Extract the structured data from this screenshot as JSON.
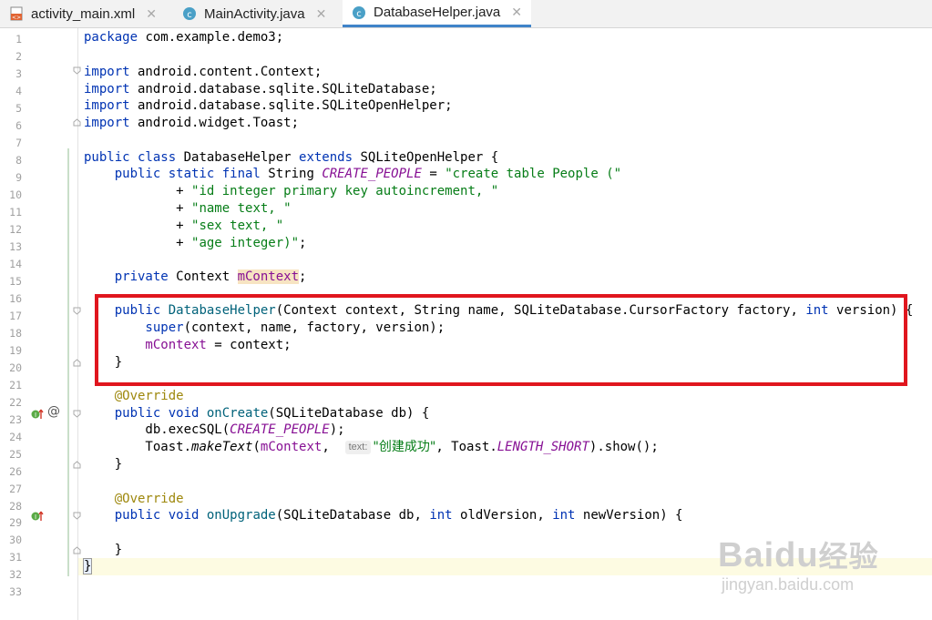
{
  "tabs": [
    {
      "label": "activity_main.xml",
      "icon": "xml-file-icon"
    },
    {
      "label": "MainActivity.java",
      "icon": "java-class-icon"
    },
    {
      "label": "DatabaseHelper.java",
      "icon": "java-class-icon",
      "active": true
    }
  ],
  "line_numbers": [
    "1",
    "2",
    "3",
    "4",
    "5",
    "6",
    "7",
    "8",
    "9",
    "10",
    "11",
    "12",
    "13",
    "14",
    "15",
    "16",
    "17",
    "18",
    "19",
    "20",
    "21",
    "22",
    "23",
    "24",
    "25",
    "26",
    "27",
    "28",
    "29",
    "30",
    "31",
    "32",
    "33"
  ],
  "code": {
    "l1": {
      "kw": "package",
      "rest": " com.example.demo3;"
    },
    "l3": {
      "kw": "import",
      "rest": " android.content.Context;"
    },
    "l4": {
      "kw": "import",
      "rest": " android.database.sqlite.SQLiteDatabase;"
    },
    "l5": {
      "kw": "import",
      "rest": " android.database.sqlite.SQLiteOpenHelper;"
    },
    "l6": {
      "kw": "import",
      "rest": " android.widget.Toast;"
    },
    "l8": {
      "kw1": "public class",
      "name": " DatabaseHelper ",
      "kw2": "extends",
      "rest": " SQLiteOpenHelper {"
    },
    "l9": {
      "kw": "    public static final",
      "type": " String ",
      "const": "CREATE_PEOPLE",
      "eq": " = ",
      "str": "\"create table People (\""
    },
    "l10": {
      "plus": "            + ",
      "str": "\"id integer primary key autoincrement, \""
    },
    "l11": {
      "plus": "            + ",
      "str": "\"name text, \""
    },
    "l12": {
      "plus": "            + ",
      "str": "\"sex text, \""
    },
    "l13": {
      "plus": "            + ",
      "str": "\"age integer)\"",
      "end": ";"
    },
    "l15": {
      "kw": "    private",
      "type": " Context ",
      "field": "mContext",
      "end": ";"
    },
    "l17": {
      "kw": "    public",
      "ctor": " DatabaseHelper",
      "args": "(Context context, String name, SQLiteDatabase.CursorFactory factory, ",
      "kw2": "int",
      "rest": " version) {"
    },
    "l18": {
      "kw": "        super",
      "rest": "(context, name, factory, version);"
    },
    "l19": {
      "field": "        mContext",
      "rest": " = context;"
    },
    "l20": {
      "rest": "    }"
    },
    "l22": {
      "ann": "    @Override"
    },
    "l23": {
      "kw": "    public void",
      "fn": " onCreate",
      "rest": "(SQLiteDatabase db) {"
    },
    "l24": {
      "pre": "        db.execSQL(",
      "const": "CREATE_PEOPLE",
      "rest": ");"
    },
    "l25": {
      "pre": "        Toast.",
      "fn": "makeText",
      "args": "(",
      "field": "mContext",
      "comma": ",  ",
      "hint": "text:",
      "str": "\"创建成功\"",
      "mid": ", Toast.",
      "const": "LENGTH_SHORT",
      "rest": ").show();"
    },
    "l26": {
      "rest": "    }"
    },
    "l28": {
      "ann": "    @Override"
    },
    "l29": {
      "kw": "    public void",
      "fn": " onUpgrade",
      "args": "(SQLiteDatabase db, ",
      "kw2": "int",
      "mid": " oldVersion, ",
      "kw3": "int",
      "rest": " newVersion) {"
    },
    "l31": {
      "rest": "    }"
    },
    "l32": {
      "rest": "}"
    }
  },
  "gutter_icons": {
    "l23_a": "implement-marker-icon",
    "l23_b": "override-at-icon",
    "l29": "implement-marker-icon"
  },
  "watermark": {
    "brand": "Baidu",
    "brand2": "经验",
    "url": "jingyan.baidu.com"
  },
  "colors": {
    "highlight_box": "#e0161e",
    "keyword": "#0033b3",
    "string": "#067d17",
    "constant": "#871094"
  }
}
